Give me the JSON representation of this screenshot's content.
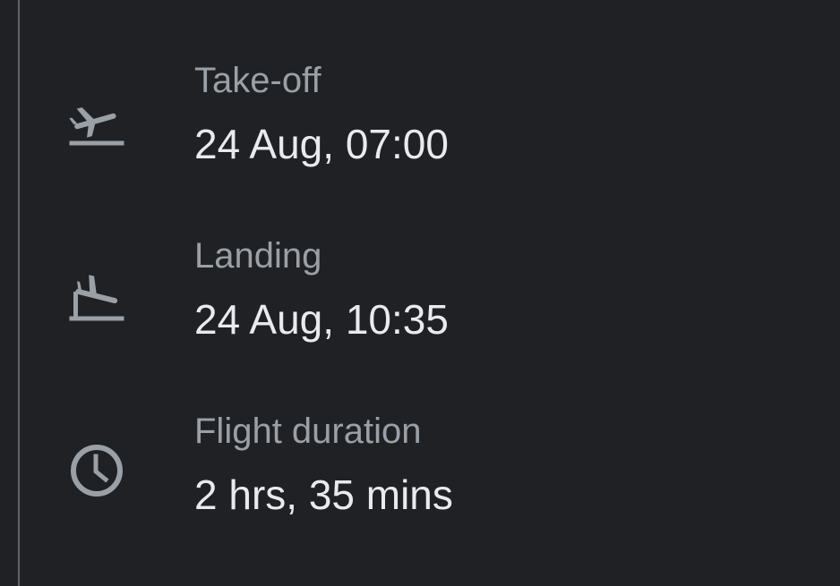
{
  "flight_details": {
    "takeoff": {
      "icon": "flight-takeoff-icon",
      "label": "Take-off",
      "value": "24 Aug, 07:00"
    },
    "landing": {
      "icon": "flight-landing-icon",
      "label": "Landing",
      "value": "24 Aug, 10:35"
    },
    "duration": {
      "icon": "clock-icon",
      "label": "Flight duration",
      "value": "2 hrs, 35 mins"
    }
  },
  "colors": {
    "background": "#202124",
    "label": "#9aa0a6",
    "value": "#e8eaed",
    "icon": "#9aa0a6",
    "rule": "#5f6368"
  }
}
